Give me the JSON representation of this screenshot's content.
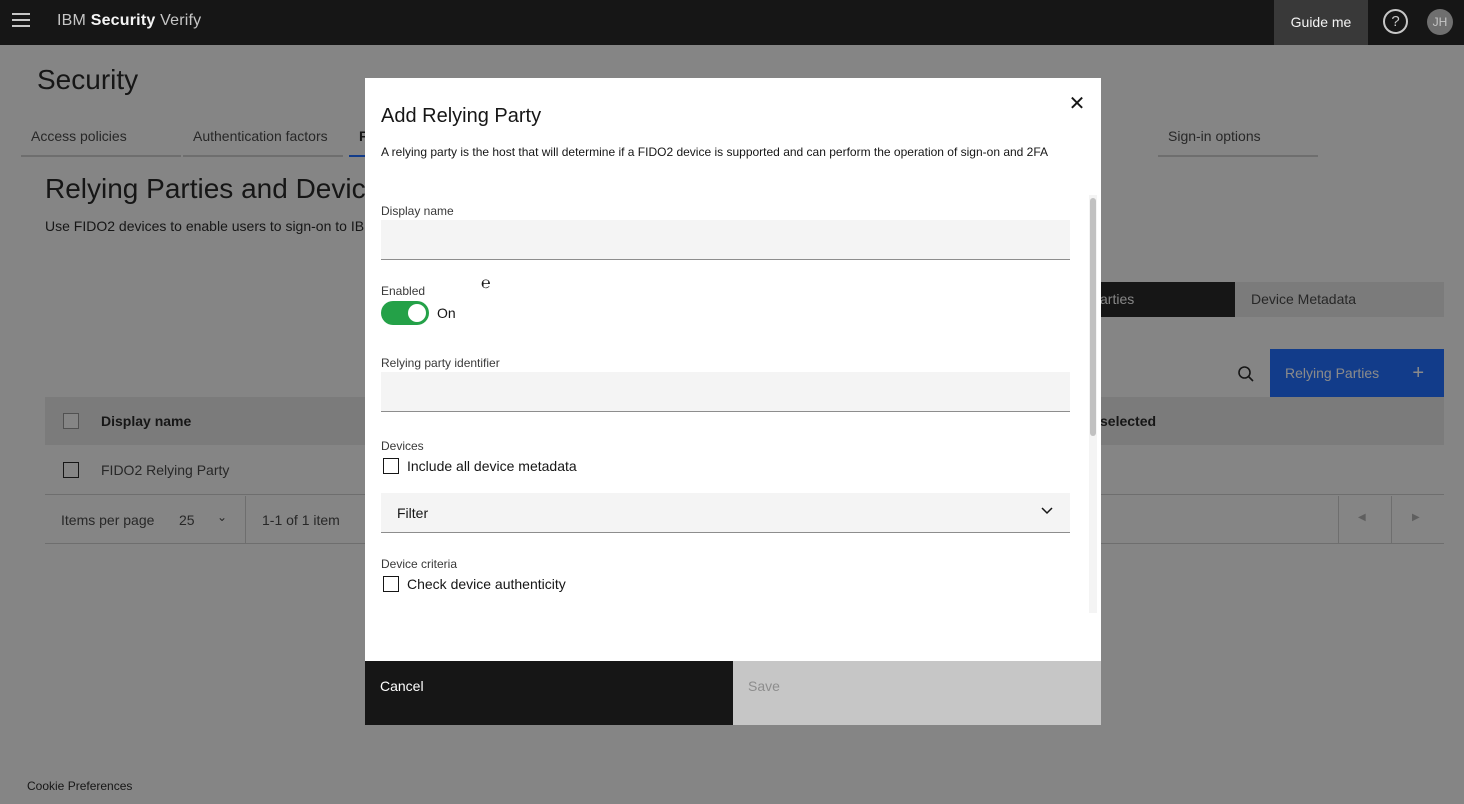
{
  "header": {
    "brand_prefix": "IBM",
    "brand_bold": "Security",
    "brand_suffix": "Verify",
    "guide_label": "Guide me",
    "help_glyph": "?",
    "avatar_initials": "JH"
  },
  "page": {
    "title": "Security",
    "tabs": [
      {
        "label": "Access policies"
      },
      {
        "label": "Authentication factors"
      },
      {
        "label": "F"
      },
      {
        "label": "Sign-in options"
      }
    ],
    "section_title": "Relying Parties and Device",
    "section_desc": "Use FIDO2 devices to enable users to sign-on to IB",
    "view_toggle": {
      "left": "arties",
      "right": "Device Metadata"
    },
    "add_button": {
      "label": "Relying Parties",
      "glyph": "+"
    },
    "table": {
      "columns": [
        "Display name",
        "selected"
      ],
      "rows": [
        {
          "display_name": "FIDO2 Relying Party"
        }
      ]
    },
    "pager": {
      "items_per_page_label": "Items per page",
      "items_per_page_value": "25",
      "range": "1-1 of 1 item"
    },
    "cookie": "Cookie Preferences"
  },
  "modal": {
    "title": "Add Relying Party",
    "description": "A relying party is the host that will determine if a FIDO2 device is supported and can perform the operation of sign-on and 2FA",
    "display_name": {
      "label": "Display name",
      "value": "",
      "placeholder": ""
    },
    "enabled": {
      "label": "Enabled",
      "state": "On"
    },
    "rp_identifier": {
      "label": "Relying party identifier",
      "value": "",
      "placeholder": ""
    },
    "devices": {
      "label": "Devices",
      "include_all_label": "Include all device metadata",
      "filter_label": "Filter"
    },
    "device_criteria": {
      "label": "Device criteria",
      "check_authenticity_label": "Check device authenticity"
    },
    "cancel_label": "Cancel",
    "save_label": "Save"
  },
  "colors": {
    "header_bg": "#161616",
    "primary": "#0f62fe",
    "toggle_on": "#24a148",
    "disabled": "#c6c6c6"
  }
}
